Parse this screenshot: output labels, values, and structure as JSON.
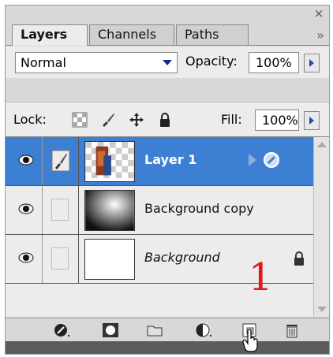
{
  "panel": {
    "close_glyph": "×",
    "tabs": [
      {
        "label": "Layers",
        "active": true
      },
      {
        "label": "Channels",
        "active": false
      },
      {
        "label": "Paths",
        "active": false
      }
    ],
    "tab_menu_glyph": "»"
  },
  "blend": {
    "mode_value": "Normal",
    "opacity_label": "Opacity:",
    "opacity_value": "100%"
  },
  "lock": {
    "label": "Lock:",
    "icons": [
      "lock-transparent-icon",
      "lock-paint-brush-icon",
      "lock-move-icon",
      "lock-all-padlock-icon"
    ],
    "fill_label": "Fill:",
    "fill_value": "100%"
  },
  "layers": [
    {
      "name": "Layer 1",
      "selected": true,
      "visible": true,
      "italic": false,
      "linked_brush": true,
      "effects": true
    },
    {
      "name": "Background copy",
      "selected": false,
      "visible": true,
      "italic": false
    },
    {
      "name": "Background",
      "selected": false,
      "visible": true,
      "italic": true,
      "locked": true
    }
  ],
  "toolbar": {
    "icons": [
      "layer-style-icon",
      "layer-mask-icon",
      "new-group-folder-icon",
      "adjustment-layer-icon",
      "new-layer-icon",
      "trash-icon"
    ]
  },
  "annotation": {
    "text": "1",
    "color": "#e01818"
  },
  "colors": {
    "selection": "#3d7fd2",
    "panel": "#d8d8d8"
  }
}
